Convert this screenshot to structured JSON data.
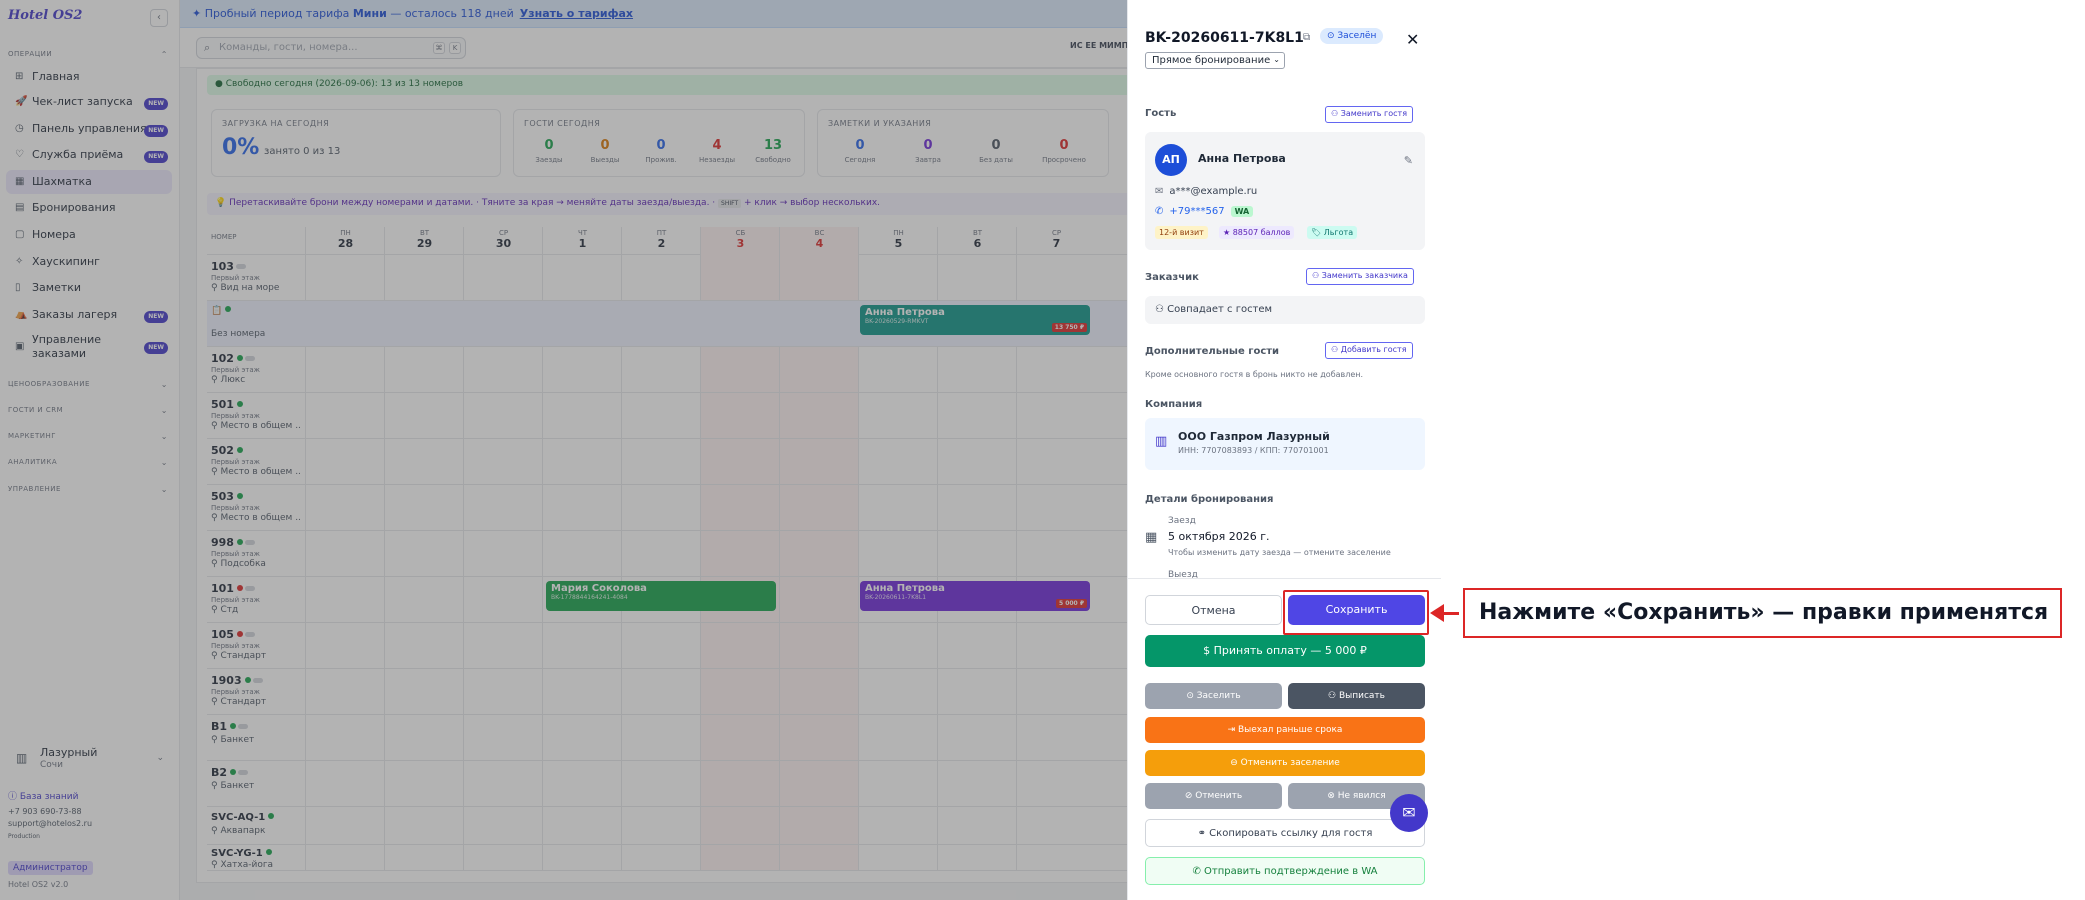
{
  "sidebar": {
    "logo": "Hotel OS2",
    "collapse": "‹",
    "sections": {
      "ops": "ОПЕРАЦИИ",
      "pricing": "ЦЕНООБРАЗОВАНИЕ",
      "guests": "ГОСТИ И CRM",
      "marketing": "МАРКЕТИНГ",
      "analytics": "АНАЛИТИКА",
      "management": "УПРАВЛЕНИЕ"
    },
    "items": [
      {
        "label": "Главная",
        "icon": "⊞"
      },
      {
        "label": "Чек-лист запуска",
        "icon": "🚀",
        "badge": "NEW"
      },
      {
        "label": "Панель управления",
        "icon": "◷",
        "badge": "NEW"
      },
      {
        "label": "Служба приёма",
        "icon": "♡",
        "badge": "NEW"
      },
      {
        "label": "Шахматка",
        "icon": "▦"
      },
      {
        "label": "Бронирования",
        "icon": "▤"
      },
      {
        "label": "Номера",
        "icon": "▢"
      },
      {
        "label": "Хаускипинг",
        "icon": "✧"
      },
      {
        "label": "Заметки",
        "icon": "▯"
      },
      {
        "label": "Заказы лагеря",
        "icon": "⛺",
        "badge": "NEW"
      },
      {
        "label": "Управление заказами",
        "icon": "▣",
        "badge": "NEW"
      }
    ],
    "hotel": {
      "name": "Лазурный",
      "city": "Сочи"
    },
    "kb": "База знаний",
    "phone": "+7 903 690-73-88",
    "email": "support@hotelos2.ru",
    "env": "Production",
    "role": "Администратор",
    "version": "Hotel OS2 v2.0"
  },
  "trial": {
    "pre": "Пробный период тарифа",
    "plan": "Мини",
    "post": "— осталось 118 дней",
    "link": "Узнать о тарифах"
  },
  "topbar": {
    "search_placeholder": "Команды, гости, номера...",
    "k1": "⌘",
    "k2": "K",
    "mm": "ИС  ЕЕ  МИМП"
  },
  "free_bar": "Свободно сегодня (2026-09-06): 13 из 13 номеров",
  "load": {
    "title": "ЗАГРУЗКА НА СЕГОДНЯ",
    "value": "0%",
    "sub": "занято 0 из 13"
  },
  "guests_today": {
    "title": "ГОСТИ СЕГОДНЯ",
    "stats": [
      {
        "v": "0",
        "l": "Заезды",
        "c": "#16a34a"
      },
      {
        "v": "0",
        "l": "Выезды",
        "c": "#d97706"
      },
      {
        "v": "0",
        "l": "Прожив.",
        "c": "#2563eb"
      },
      {
        "v": "4",
        "l": "Незаезды",
        "c": "#dc2626"
      },
      {
        "v": "13",
        "l": "Свободно",
        "c": "#16a34a"
      }
    ]
  },
  "notes": {
    "title": "ЗАМЕТКИ И УКАЗАНИЯ",
    "stats": [
      {
        "v": "0",
        "l": "Сегодня",
        "c": "#2563eb"
      },
      {
        "v": "0",
        "l": "Завтра",
        "c": "#6d28d9"
      },
      {
        "v": "0",
        "l": "Без даты",
        "c": "#4b5563"
      },
      {
        "v": "0",
        "l": "Просрочено",
        "c": "#dc2626"
      }
    ]
  },
  "hint": {
    "a": "💡 Перетаскивайте брони между номерами и датами.  · Тяните за края → меняйте даты заезда/выезда.  · ",
    "k": "SHIFT",
    "b": " + клик → выбор нескольких."
  },
  "grid": {
    "num_header": "НОМЕР",
    "dates": [
      {
        "w": "ПН",
        "d": "28"
      },
      {
        "w": "ВТ",
        "d": "29"
      },
      {
        "w": "СР",
        "d": "30"
      },
      {
        "w": "ЧТ",
        "d": "1"
      },
      {
        "w": "ПТ",
        "d": "2"
      },
      {
        "w": "СБ",
        "d": "3"
      },
      {
        "w": "ВС",
        "d": "4"
      },
      {
        "w": "ПН",
        "d": "5"
      },
      {
        "w": "ВТ",
        "d": "6"
      },
      {
        "w": "СР",
        "d": "7"
      }
    ],
    "rooms": [
      {
        "no": "103",
        "floor": "Первый этаж",
        "type": "Вид на море"
      },
      {
        "no": "📋",
        "floor": "",
        "type": "Без номера"
      },
      {
        "no": "102",
        "floor": "Первый этаж",
        "type": "Люкс"
      },
      {
        "no": "501",
        "floor": "Первый этаж",
        "type": "Место в общем ..."
      },
      {
        "no": "502",
        "floor": "Первый этаж",
        "type": "Место в общем ..."
      },
      {
        "no": "503",
        "floor": "Первый этаж",
        "type": "Место в общем ..."
      },
      {
        "no": "998",
        "floor": "Первый этаж",
        "type": "Подсобка"
      },
      {
        "no": "101",
        "floor": "Первый этаж",
        "type": "Стд"
      },
      {
        "no": "105",
        "floor": "Первый этаж",
        "type": "Стандарт"
      },
      {
        "no": "1903",
        "floor": "Первый этаж",
        "type": "Стандарт"
      },
      {
        "no": "B1",
        "floor": "",
        "type": "Банкет"
      },
      {
        "no": "B2",
        "floor": "",
        "type": "Банкет"
      },
      {
        "no": "SVC-AQ-1",
        "floor": "",
        "type": "Аквапарк"
      },
      {
        "no": "SVC-YG-1",
        "floor": "",
        "type": "Хатха-йога"
      }
    ],
    "bookings": [
      {
        "name": "Анна Петрова",
        "code": "BK-20260529-RMKVT",
        "price": "13 750 ₽"
      },
      {
        "name": "Мария Соколова",
        "code": "BK-1778844164241-4084",
        "price": ""
      },
      {
        "name": "Анна Петрова",
        "code": "BK-20260611-7K8L1",
        "price": "5 000 ₽"
      }
    ]
  },
  "drawer": {
    "title": "BK-20260611-7K8L1",
    "status": "Заселён",
    "source": "Прямое бронирование",
    "guest_label": "Гость",
    "replace_guest": "Заменить гостя",
    "guest": {
      "initials": "АП",
      "name": "Анна Петрова",
      "email": "a***@example.ru",
      "phone": "+79***567",
      "wa": "WA",
      "tags": [
        "12-й визит",
        "★ 88507 баллов",
        "🏷 Льгота"
      ]
    },
    "customer_label": "Заказчик",
    "replace_customer": "Заменить заказчика",
    "customer_value": "Совпадает с гостем",
    "extra_label": "Дополнительные гости",
    "add_guest": "Добавить гостя",
    "extra_empty": "Кроме основного гостя в бронь никто не добавлен.",
    "company_label": "Компания",
    "company": {
      "name": "ООО Газпром Лазурный",
      "details": "ИНН: 7707083893 / КПП: 770701001"
    },
    "details_label": "Детали бронирования",
    "checkin_label": "Заезд",
    "checkin_date": "5 октября 2026 г.",
    "checkin_hint": "Чтобы изменить дату заезда — отмените заселение",
    "checkout_label": "Выезд",
    "cancel": "Отмена",
    "save": "Сохранить",
    "pay": "Принять оплату — 5 000 ₽",
    "checkin_btn": "Заселить",
    "checkout_btn": "Выписать",
    "early": "Выехал раньше срока",
    "cancel_checkin": "Отменить заселение",
    "cancel_booking": "Отменить",
    "noshow": "Не явился",
    "copy_link": "Скопировать ссылку для гостя",
    "send_wa": "Отправить подтверждение в WA"
  },
  "annotation": "Нажмите «Сохранить» — правки применятся"
}
